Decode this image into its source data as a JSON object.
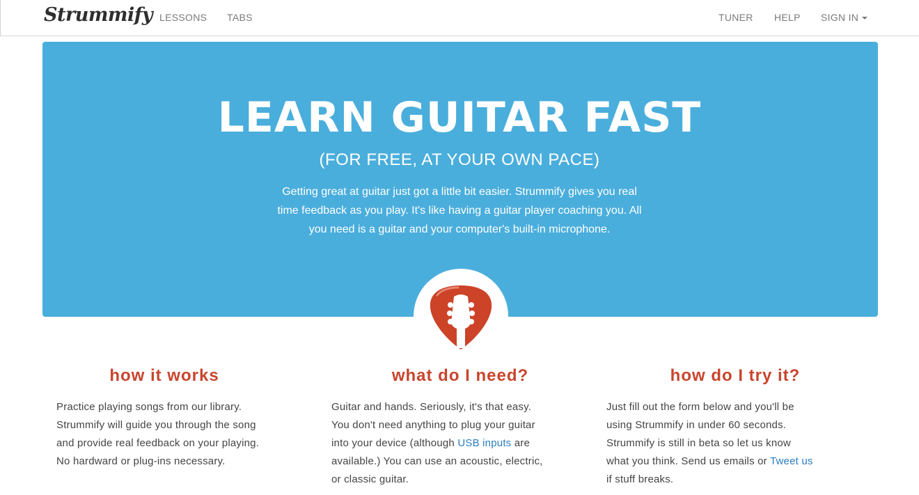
{
  "nav": {
    "brand": "Strummify",
    "left_links": [
      "LESSONS",
      "TABS"
    ],
    "right_links": [
      "TUNER",
      "HELP"
    ],
    "sign_in": "SIGN IN"
  },
  "hero": {
    "title": "LEARN GUITAR FAST",
    "subtitle": "(FOR FREE, AT YOUR OWN PACE)",
    "text_lines": [
      "Getting great at guitar just got a little bit easier. Strummify gives you real",
      "time feedback as you play. It's like having a guitar player coaching you. All",
      "you need is a guitar and your computer's built-in microphone."
    ],
    "background_color": "#4aaedc"
  },
  "logo": {
    "icon": "guitar-pick-icon",
    "color": "#cc4328"
  },
  "columns": [
    {
      "heading": "how it works",
      "lines": [
        "Practice playing songs from our library.",
        "Strummify will guide you through the song",
        "and provide real feedback on your playing.",
        "No hardward or plug-ins necessary."
      ]
    },
    {
      "heading": "what do I need?",
      "line1": "Guitar and hands. Seriously, it's that easy.",
      "line2": "You don't need anything to plug your guitar",
      "line3_pre": "into your device (although ",
      "line3_link": "USB inputs",
      "line3_post": " are",
      "line4": "available.) You can use an acoustic, electric,",
      "line5": "or classic guitar."
    },
    {
      "heading": "how do I try it?",
      "line1": "Just fill out the form below and you'll be",
      "line2": "using Strummify in under 60 seconds.",
      "line3": "Strummify is still in beta so let us know",
      "line4_pre": "what you think. Send us emails or ",
      "line4_link": "Tweet us",
      "line5": "if stuff breaks."
    }
  ],
  "colors": {
    "heading": "#c8452d",
    "link": "#2a7ec0"
  }
}
